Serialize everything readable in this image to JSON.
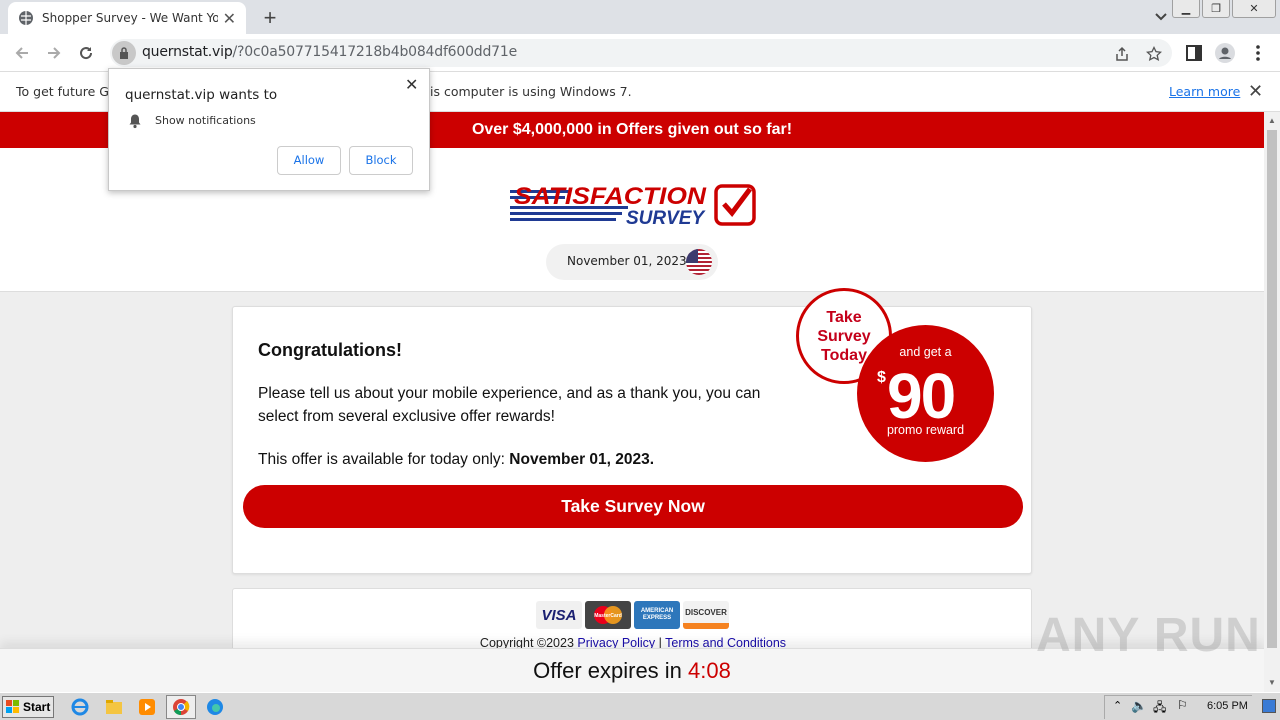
{
  "browser": {
    "tab_title": "Shopper Survey - We Want Your Op",
    "url_domain": "quernstat.vip",
    "url_path": "/?0c0a507715417218b4b084df600dd71e"
  },
  "infobar": {
    "message_left": "To get future Go",
    "message_right": "is computer is using Windows 7.",
    "learn_more": "Learn more"
  },
  "popup": {
    "title": "quernstat.vip wants to",
    "permission": "Show notifications",
    "allow": "Allow",
    "block": "Block"
  },
  "page": {
    "banner": "Over $4,000,000 in Offers given out so far!",
    "logo_line1": "SATISFACTION",
    "logo_line2": "SURVEY",
    "date": "November 01, 2023",
    "heading": "Congratulations!",
    "paragraph": "Please tell us about your mobile experience, and as a thank you, you can select from several exclusive offer rewards!",
    "offer_prefix": "This offer is available for today only: ",
    "offer_date": "November 01, 2023.",
    "cta": "Take Survey Now",
    "badge_take_line1": "Take",
    "badge_take_line2": "Survey",
    "badge_take_line3": "Today",
    "badge_get": "and get a",
    "badge_dollar": "$",
    "badge_amount": "90",
    "badge_reward": "promo reward",
    "cards": [
      "VISA",
      "MasterCard",
      "AMERICAN EXPRESS",
      "DISCOVER"
    ],
    "copyright": "Copyright ©2023 ",
    "privacy": "Privacy Policy",
    "separator": " | ",
    "terms": "Terms and Conditions",
    "expires_label": "Offer expires in ",
    "expires_time": "4:08"
  },
  "watermark": "ANY RUN",
  "taskbar": {
    "start": "Start",
    "clock": "6:05 PM"
  },
  "colors": {
    "brand_red": "#cc0000",
    "logo_blue": "#1f3a93"
  }
}
